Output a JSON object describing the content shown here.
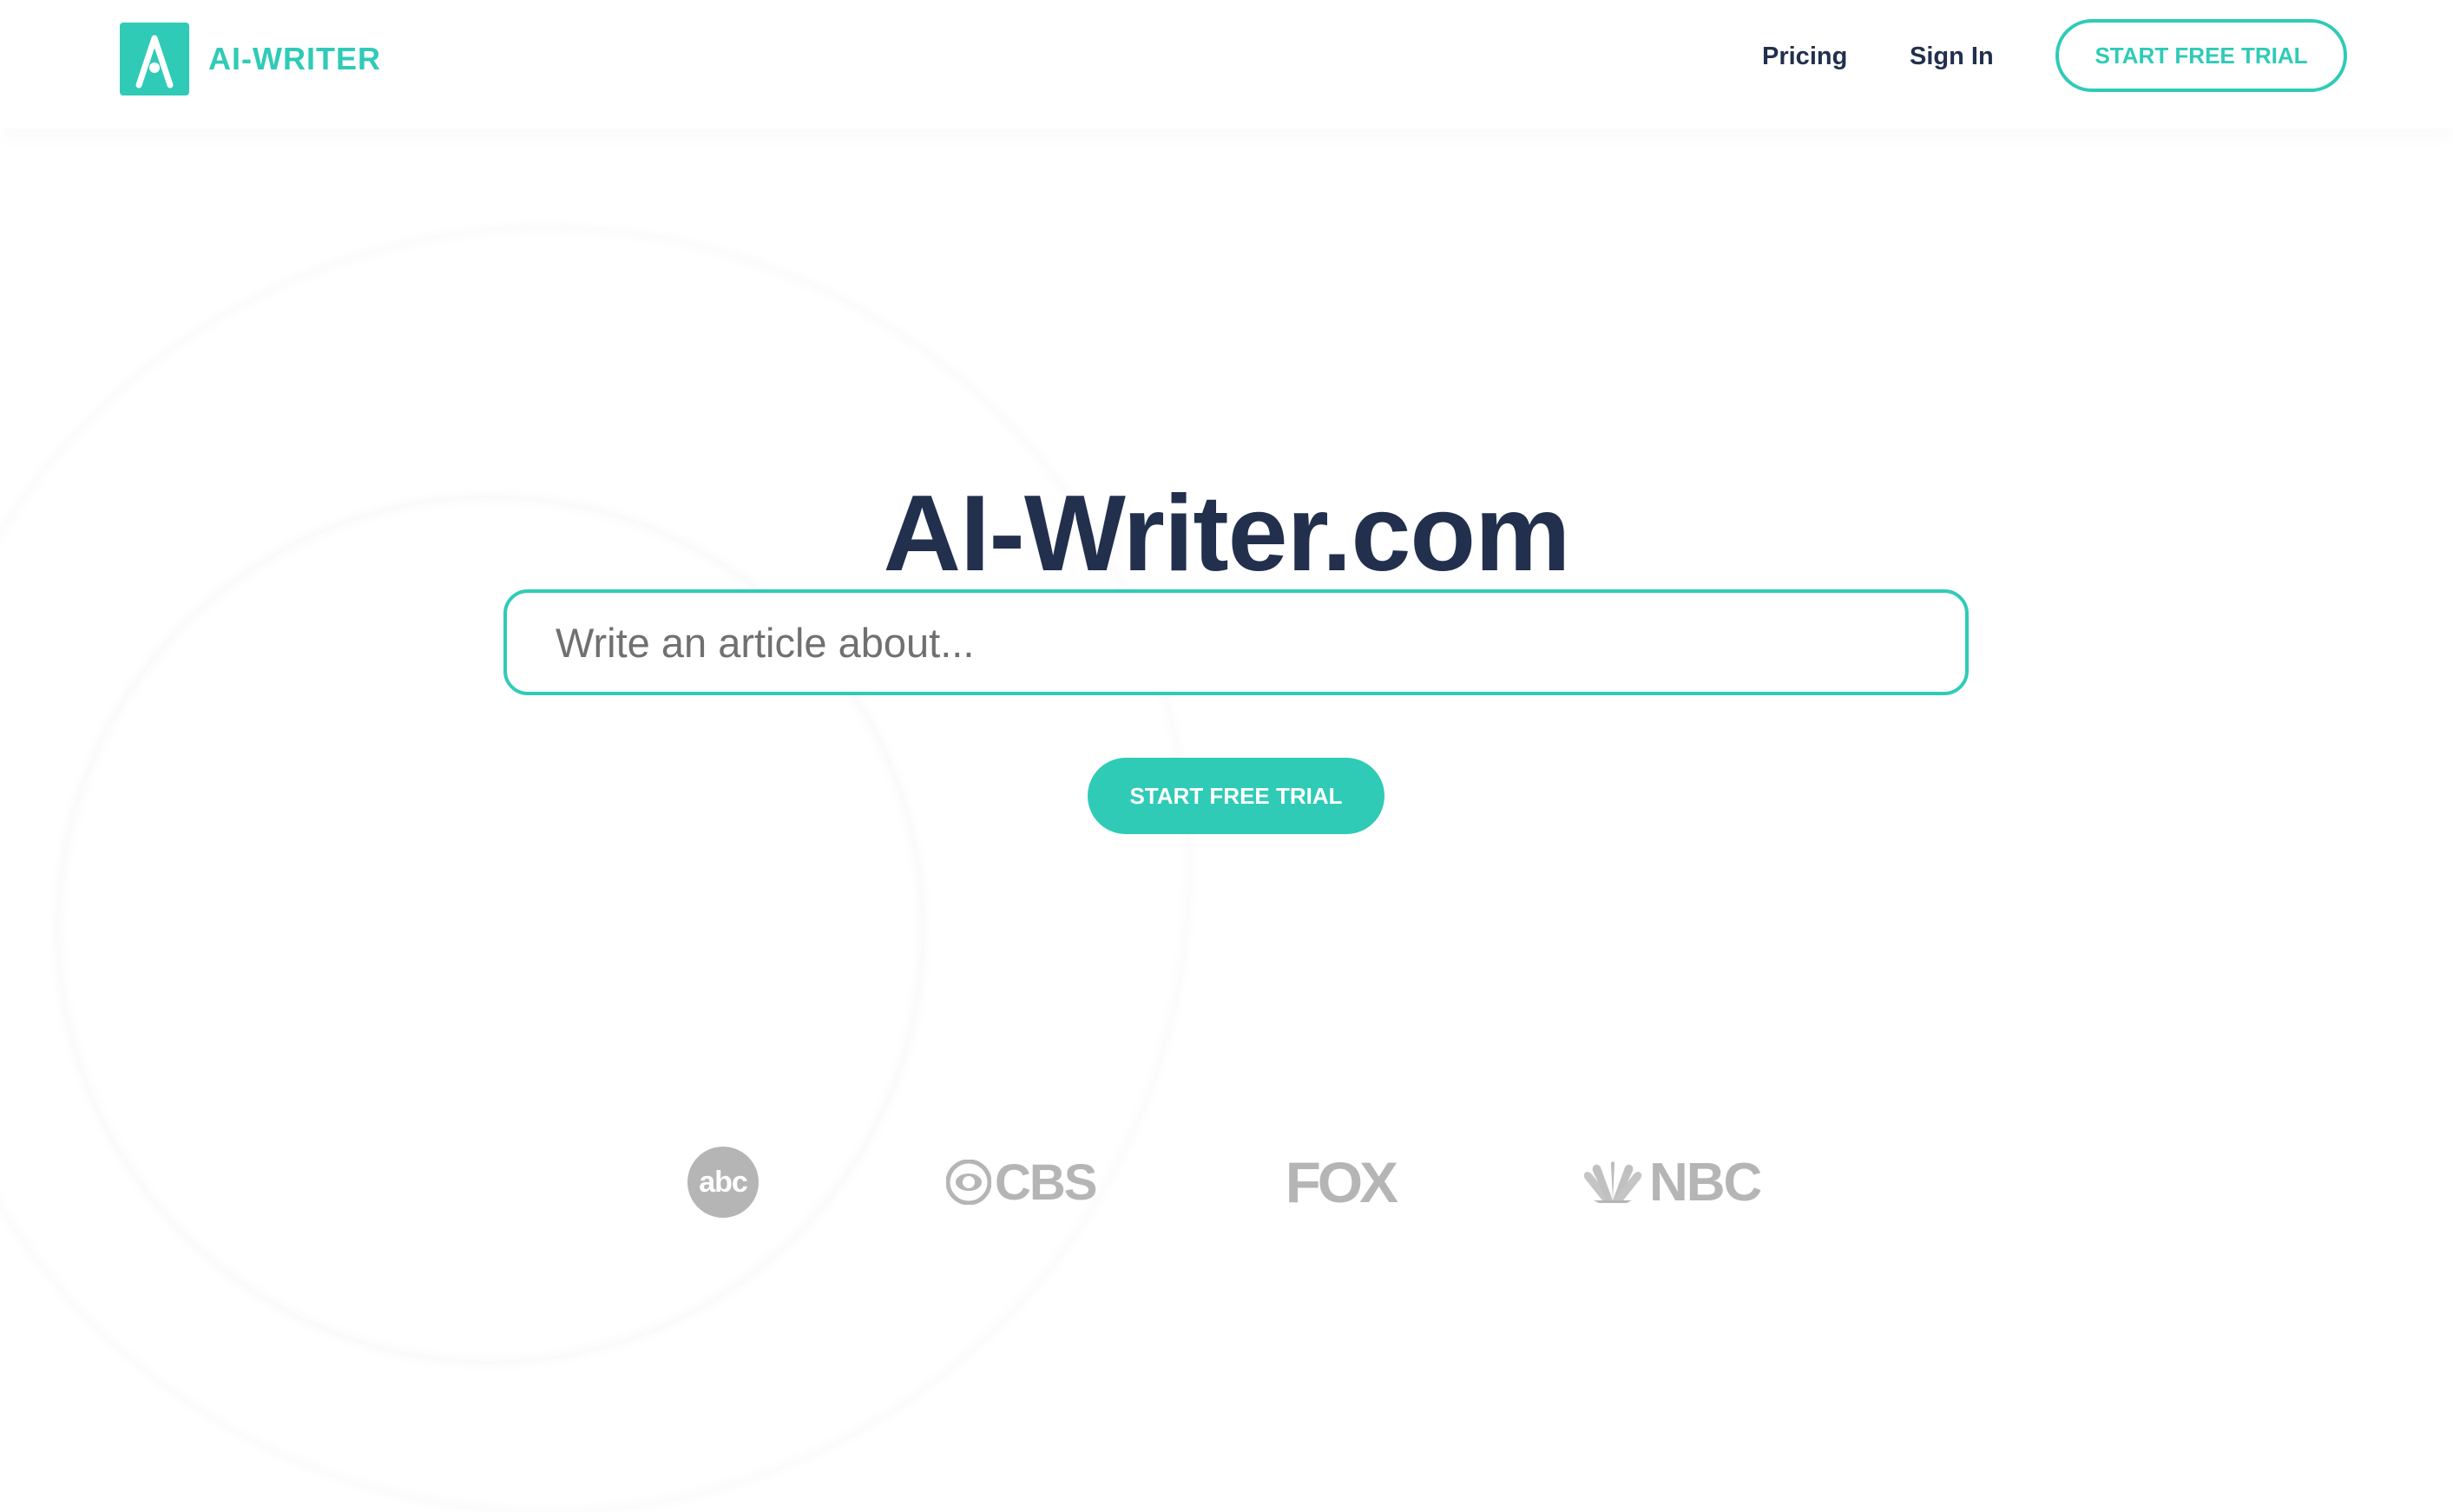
{
  "brand": {
    "name": "AI-WRITER",
    "logo_letter": "A",
    "logo_icon": "ai-writer-logo-icon",
    "color": "#2fcbb7"
  },
  "nav": {
    "pricing": "Pricing",
    "sign_in": "Sign In",
    "cta": "START FREE TRIAL"
  },
  "hero": {
    "title": "AI-Writer.com",
    "search_placeholder": "Write an article about...",
    "search_value": "",
    "cta": "START FREE TRIAL"
  },
  "logos": [
    {
      "name": "abc",
      "text": "abc",
      "icon": "abc-logo"
    },
    {
      "name": "cbs",
      "text": "CBS",
      "icon": "cbs-logo"
    },
    {
      "name": "fox",
      "text": "FOX",
      "icon": "fox-logo"
    },
    {
      "name": "nbc",
      "text": "NBC",
      "icon": "nbc-logo"
    }
  ],
  "colors": {
    "accent": "#2fcbb7",
    "heading": "#22304e",
    "muted_logo": "#b5b5b5",
    "input_text": "#707070"
  }
}
